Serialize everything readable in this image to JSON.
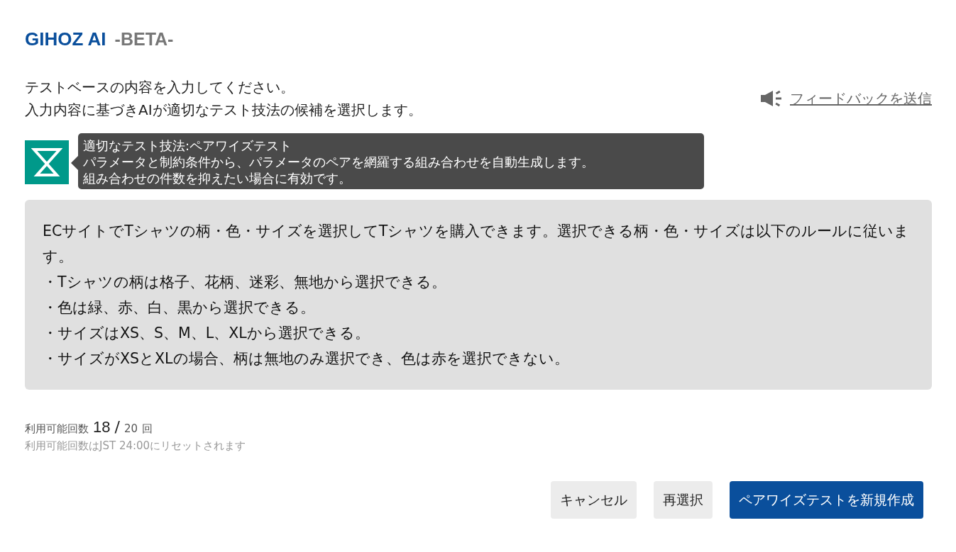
{
  "header": {
    "title": "GIHOZ AI",
    "badge": "-BETA-"
  },
  "instructions": [
    "テストベースの内容を入力してください。",
    "入力内容に基づきAIが適切なテスト技法の候補を選択します。"
  ],
  "feedback_link": "フィードバックを送信",
  "technique_tooltip": {
    "title": "適切なテスト技法:ペアワイズテスト",
    "lines": [
      "パラメータと制約条件から、パラメータのペアを網羅する組み合わせを自動生成します。",
      "組み合わせの件数を抑えたい場合に有効です。"
    ]
  },
  "test_base": {
    "intro": "ECサイトでTシャツの柄・色・サイズを選択してTシャツを購入できます。選択できる柄・色・サイズは以下のルールに従います。",
    "bullets": [
      "・Tシャツの柄は格子、花柄、迷彩、無地から選択できる。",
      "・色は緑、赤、白、黒から選択できる。",
      "・サイズはXS、S、M、L、XLから選択できる。",
      "・サイズがXSとXLの場合、柄は無地のみ選択でき、色は赤を選択できない。"
    ]
  },
  "usage": {
    "label": "利用可能回数",
    "remaining": "18",
    "separator": "/",
    "total": "20",
    "unit": "回",
    "note": "利用可能回数はJST 24:00にリセットされます"
  },
  "buttons": [
    {
      "label": "キャンセル",
      "kind": "secondary"
    },
    {
      "label": "再選択",
      "kind": "secondary"
    },
    {
      "label": "ペアワイズテストを新規作成",
      "kind": "primary"
    }
  ]
}
